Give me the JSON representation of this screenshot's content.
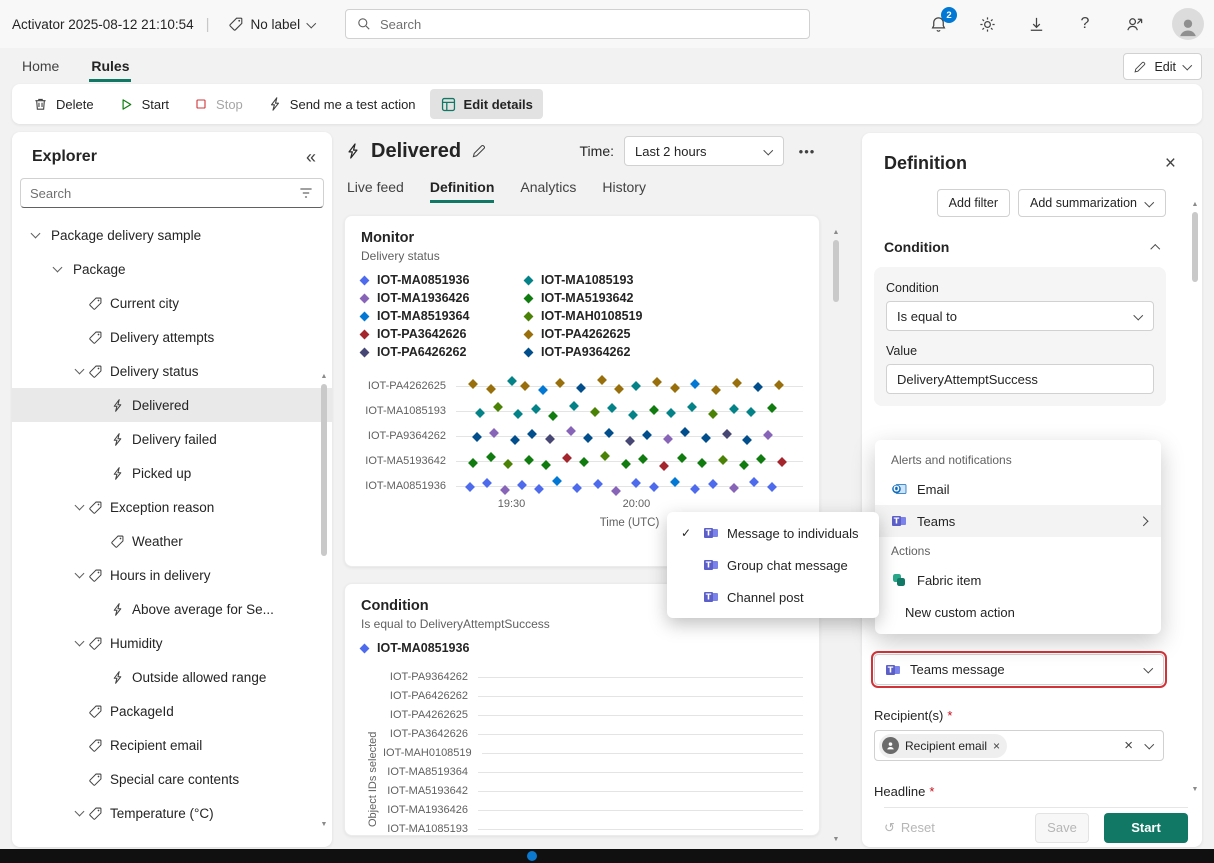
{
  "topbar": {
    "title": "Activator 2025-08-12 21:10:54",
    "label_button": "No label",
    "search_placeholder": "Search",
    "notification_count": "2"
  },
  "nav": {
    "home": "Home",
    "rules": "Rules",
    "edit_button": "Edit"
  },
  "toolbar": {
    "delete": "Delete",
    "start": "Start",
    "stop": "Stop",
    "test_action": "Send me a test action",
    "edit_details": "Edit details"
  },
  "explorer": {
    "title": "Explorer",
    "search_placeholder": "Search",
    "tree": [
      {
        "label": "Package delivery sample",
        "level": 0,
        "icon": "none",
        "expanded": true
      },
      {
        "label": "Package",
        "level": 1,
        "icon": "none",
        "expanded": true
      },
      {
        "label": "Current city",
        "level": 2,
        "icon": "tag"
      },
      {
        "label": "Delivery attempts",
        "level": 2,
        "icon": "tag"
      },
      {
        "label": "Delivery status",
        "level": 2,
        "icon": "tag",
        "expanded": true
      },
      {
        "label": "Delivered",
        "level": 3,
        "icon": "bolt",
        "selected": true
      },
      {
        "label": "Delivery failed",
        "level": 3,
        "icon": "bolt"
      },
      {
        "label": "Picked up",
        "level": 3,
        "icon": "bolt"
      },
      {
        "label": "Exception reason",
        "level": 2,
        "icon": "tag",
        "expanded": true
      },
      {
        "label": "Weather",
        "level": 3,
        "icon": "tag"
      },
      {
        "label": "Hours in delivery",
        "level": 2,
        "icon": "tag",
        "expanded": true
      },
      {
        "label": "Above average for Se...",
        "level": 3,
        "icon": "bolt"
      },
      {
        "label": "Humidity",
        "level": 2,
        "icon": "tag",
        "expanded": true
      },
      {
        "label": "Outside allowed range",
        "level": 3,
        "icon": "bolt"
      },
      {
        "label": "PackageId",
        "level": 2,
        "icon": "tag"
      },
      {
        "label": "Recipient email",
        "level": 2,
        "icon": "tag"
      },
      {
        "label": "Special care contents",
        "level": 2,
        "icon": "tag"
      },
      {
        "label": "Temperature (°C)",
        "level": 2,
        "icon": "tag",
        "expanded": true
      }
    ]
  },
  "main": {
    "title": "Delivered",
    "time_label": "Time:",
    "time_value": "Last 2 hours",
    "tabs": [
      "Live feed",
      "Definition",
      "Analytics",
      "History"
    ]
  },
  "context_menu": {
    "items": [
      {
        "label": "Message to individuals",
        "checked": true
      },
      {
        "label": "Group chat message",
        "checked": false
      },
      {
        "label": "Channel post",
        "checked": false
      }
    ]
  },
  "panel": {
    "title": "Definition",
    "add_filter": "Add filter",
    "add_summarization": "Add summarization",
    "section_condition": "Condition",
    "condition_label": "Condition",
    "condition_value": "Is equal to",
    "value_label": "Value",
    "value_text": "DeliveryAttemptSuccess",
    "menu_group_alerts": "Alerts and notifications",
    "menu_email": "Email",
    "menu_teams": "Teams",
    "menu_group_actions": "Actions",
    "menu_fabric": "Fabric item",
    "menu_custom": "New custom action",
    "action_select": "Teams message",
    "recipients_label": "Recipient(s)",
    "required_mark": "*",
    "recipient_chip": "Recipient email",
    "headline_label": "Headline",
    "reset": "Reset",
    "save": "Save",
    "start": "Start"
  },
  "colors": {
    "accent": "#117865",
    "badge": "#0078d4",
    "annotation": "#d13438"
  },
  "chart_data": [
    {
      "type": "scatter",
      "title": "Monitor",
      "subtitle": "Delivery status",
      "xlabel": "Time (UTC)",
      "x_ticks": [
        {
          "label": "19:30",
          "pos": 0.16
        },
        {
          "label": "20:00",
          "pos": 0.52
        }
      ],
      "rows": [
        "IOT-PA4262625",
        "IOT-MA1085193",
        "IOT-PA9364262",
        "IOT-MA5193642",
        "IOT-MA0851936"
      ],
      "legend": [
        {
          "name": "IOT-MA0851936",
          "color": "#4f6bed"
        },
        {
          "name": "IOT-MA1085193",
          "color": "#038387"
        },
        {
          "name": "IOT-MA1936426",
          "color": "#8764b8"
        },
        {
          "name": "IOT-MA5193642",
          "color": "#107c10"
        },
        {
          "name": "IOT-MA8519364",
          "color": "#0078d4"
        },
        {
          "name": "IOT-MAH0108519",
          "color": "#498205"
        },
        {
          "name": "IOT-PA3642626",
          "color": "#a4262c"
        },
        {
          "name": "IOT-PA4262625",
          "color": "#986f0b"
        },
        {
          "name": "IOT-PA6426262",
          "color": "#464775"
        },
        {
          "name": "IOT-PA9364262",
          "color": "#004e8c"
        }
      ],
      "points": [
        [
          0,
          0.05,
          7,
          -2
        ],
        [
          0,
          0.1,
          7,
          3
        ],
        [
          0,
          0.16,
          1,
          -5
        ],
        [
          0,
          0.2,
          7,
          0
        ],
        [
          0,
          0.25,
          4,
          4
        ],
        [
          0,
          0.3,
          7,
          -3
        ],
        [
          0,
          0.36,
          9,
          2
        ],
        [
          0,
          0.42,
          7,
          -6
        ],
        [
          0,
          0.47,
          7,
          3
        ],
        [
          0,
          0.52,
          1,
          0
        ],
        [
          0,
          0.58,
          7,
          -4
        ],
        [
          0,
          0.63,
          7,
          2
        ],
        [
          0,
          0.69,
          4,
          -2
        ],
        [
          0,
          0.75,
          7,
          4
        ],
        [
          0,
          0.81,
          7,
          -3
        ],
        [
          0,
          0.87,
          9,
          1
        ],
        [
          0,
          0.93,
          7,
          -1
        ],
        [
          1,
          0.07,
          1,
          2
        ],
        [
          1,
          0.12,
          5,
          -4
        ],
        [
          1,
          0.18,
          1,
          3
        ],
        [
          1,
          0.23,
          1,
          -2
        ],
        [
          1,
          0.28,
          3,
          5
        ],
        [
          1,
          0.34,
          1,
          -5
        ],
        [
          1,
          0.4,
          5,
          1
        ],
        [
          1,
          0.45,
          1,
          -3
        ],
        [
          1,
          0.51,
          1,
          4
        ],
        [
          1,
          0.57,
          3,
          -1
        ],
        [
          1,
          0.62,
          1,
          2
        ],
        [
          1,
          0.68,
          1,
          -4
        ],
        [
          1,
          0.74,
          5,
          3
        ],
        [
          1,
          0.8,
          1,
          -2
        ],
        [
          1,
          0.85,
          1,
          1
        ],
        [
          1,
          0.91,
          3,
          -3
        ],
        [
          2,
          0.06,
          9,
          1
        ],
        [
          2,
          0.11,
          2,
          -3
        ],
        [
          2,
          0.17,
          9,
          4
        ],
        [
          2,
          0.22,
          9,
          -2
        ],
        [
          2,
          0.27,
          8,
          3
        ],
        [
          2,
          0.33,
          2,
          -5
        ],
        [
          2,
          0.38,
          9,
          2
        ],
        [
          2,
          0.44,
          9,
          -3
        ],
        [
          2,
          0.5,
          8,
          5
        ],
        [
          2,
          0.55,
          9,
          -1
        ],
        [
          2,
          0.61,
          2,
          3
        ],
        [
          2,
          0.66,
          9,
          -4
        ],
        [
          2,
          0.72,
          9,
          2
        ],
        [
          2,
          0.78,
          8,
          -2
        ],
        [
          2,
          0.84,
          9,
          4
        ],
        [
          2,
          0.9,
          2,
          -1
        ],
        [
          3,
          0.05,
          3,
          2
        ],
        [
          3,
          0.1,
          3,
          -4
        ],
        [
          3,
          0.15,
          5,
          3
        ],
        [
          3,
          0.21,
          3,
          -1
        ],
        [
          3,
          0.26,
          3,
          4
        ],
        [
          3,
          0.32,
          6,
          -3
        ],
        [
          3,
          0.37,
          3,
          1
        ],
        [
          3,
          0.43,
          5,
          -5
        ],
        [
          3,
          0.49,
          3,
          3
        ],
        [
          3,
          0.54,
          3,
          -2
        ],
        [
          3,
          0.6,
          6,
          5
        ],
        [
          3,
          0.65,
          3,
          -3
        ],
        [
          3,
          0.71,
          3,
          2
        ],
        [
          3,
          0.77,
          5,
          -1
        ],
        [
          3,
          0.83,
          3,
          4
        ],
        [
          3,
          0.88,
          3,
          -2
        ],
        [
          3,
          0.94,
          6,
          1
        ],
        [
          4,
          0.04,
          0,
          1
        ],
        [
          4,
          0.09,
          0,
          -3
        ],
        [
          4,
          0.14,
          2,
          4
        ],
        [
          4,
          0.19,
          0,
          -1
        ],
        [
          4,
          0.24,
          0,
          3
        ],
        [
          4,
          0.29,
          4,
          -5
        ],
        [
          4,
          0.35,
          0,
          2
        ],
        [
          4,
          0.41,
          0,
          -2
        ],
        [
          4,
          0.46,
          2,
          5
        ],
        [
          4,
          0.52,
          0,
          -3
        ],
        [
          4,
          0.57,
          0,
          1
        ],
        [
          4,
          0.63,
          4,
          -4
        ],
        [
          4,
          0.69,
          0,
          3
        ],
        [
          4,
          0.74,
          0,
          -2
        ],
        [
          4,
          0.8,
          2,
          2
        ],
        [
          4,
          0.86,
          0,
          -4
        ],
        [
          4,
          0.91,
          0,
          1
        ]
      ]
    },
    {
      "type": "scatter",
      "title": "Condition",
      "subtitle": "Is equal to DeliveryAttemptSuccess",
      "ylabel": "Object IDs selected",
      "rows": [
        "IOT-PA9364262",
        "IOT-PA6426262",
        "IOT-PA4262625",
        "IOT-PA3642626",
        "IOT-MAH0108519",
        "IOT-MA8519364",
        "IOT-MA5193642",
        "IOT-MA1936426",
        "IOT-MA1085193"
      ],
      "legend": [
        {
          "name": "IOT-MA0851936",
          "color": "#4f6bed"
        }
      ],
      "points": []
    }
  ]
}
